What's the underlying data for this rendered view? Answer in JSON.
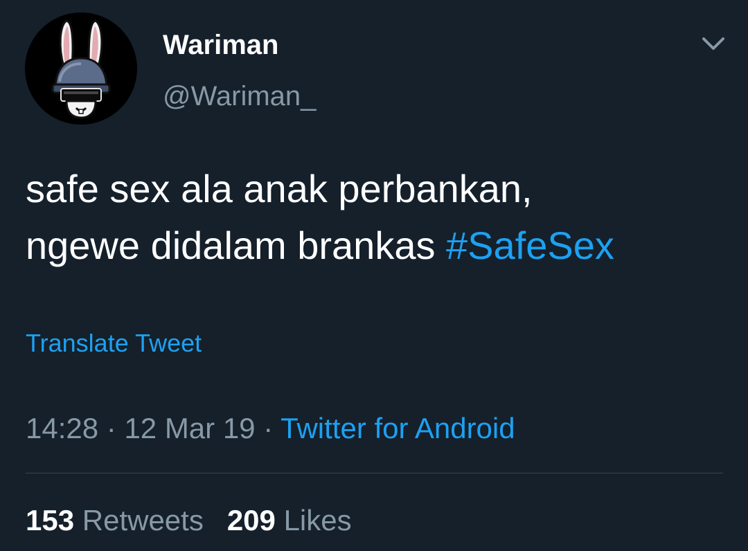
{
  "tweet": {
    "author": {
      "display_name": "Wariman",
      "handle": "@Wariman_",
      "avatar_icon": "bunny-helmet-avatar"
    },
    "menu_icon": "chevron-down-icon",
    "text_line1": "safe sex ala anak perbankan,",
    "text_line2": "ngewe didalam brankas ",
    "hashtag": "#SafeSex",
    "translate_label": "Translate Tweet",
    "meta": {
      "time": "14:28",
      "separator": " · ",
      "date": "12 Mar 19",
      "source": "Twitter for Android"
    },
    "stats": {
      "retweets_count": "153",
      "retweets_label": "Retweets",
      "likes_count": "209",
      "likes_label": "Likes"
    }
  },
  "colors": {
    "background": "#15202b",
    "text_primary": "#ffffff",
    "text_secondary": "#8899a6",
    "accent": "#1da1f2",
    "divider": "#38444d"
  }
}
